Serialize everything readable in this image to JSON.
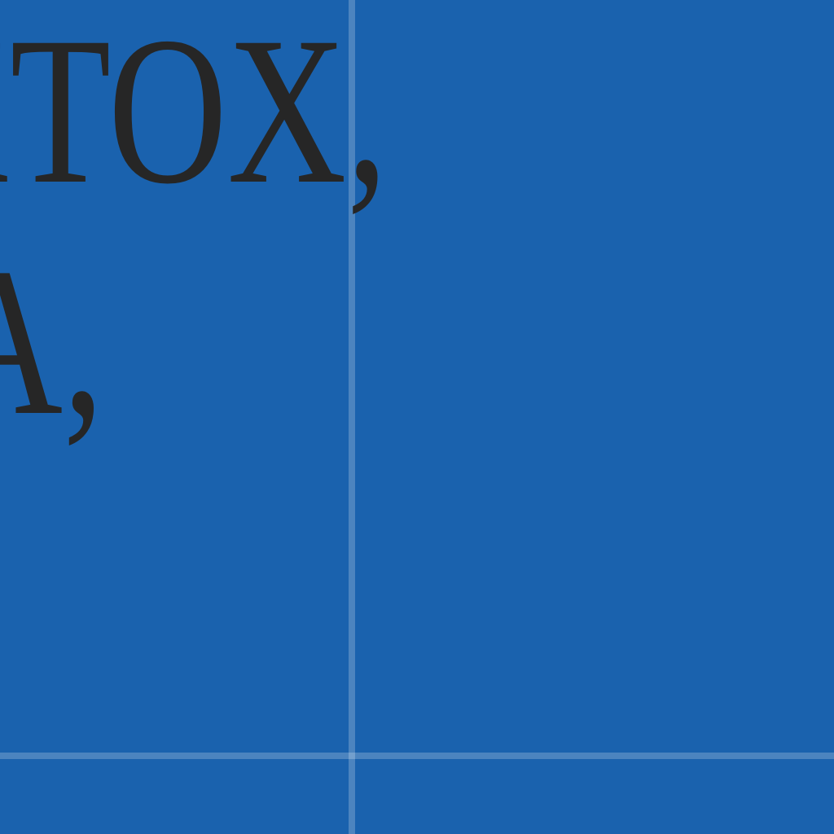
{
  "text": {
    "line_1": "EXTOX,",
    "line_2": "A,"
  },
  "colors": {
    "background": "#1a62ae",
    "text": "#262626",
    "grid_lines": "#4f86c4"
  }
}
